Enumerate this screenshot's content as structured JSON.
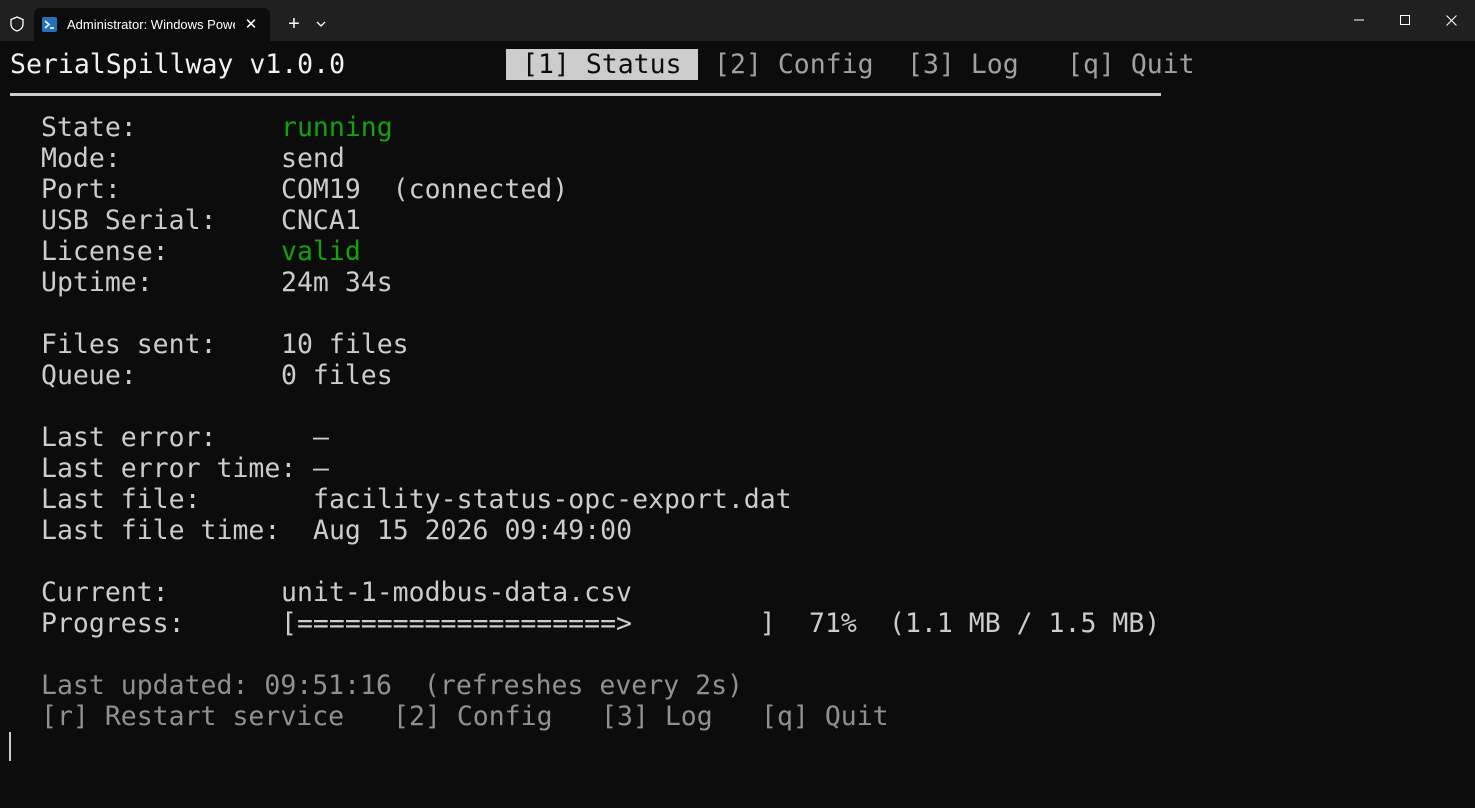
{
  "titlebar": {
    "tab_title": "Administrator: Windows PowerShell",
    "tab_close": "✕",
    "new_tab": "+"
  },
  "app": {
    "title": "SerialSpillway v1.0.0"
  },
  "menu": {
    "status": "[1] Status",
    "config": "[2] Config",
    "log": "[3] Log",
    "quit": "[q] Quit"
  },
  "status": {
    "state_label": "State:",
    "state_value": "running",
    "mode_label": "Mode:",
    "mode_value": "send",
    "port_label": "Port:",
    "port_value": "COM19  (connected)",
    "usb_label": "USB Serial:",
    "usb_value": "CNCA1",
    "license_label": "License:",
    "license_value": "valid",
    "uptime_label": "Uptime:",
    "uptime_value": "24m 34s",
    "files_sent_label": "Files sent:",
    "files_sent_value": "10 files",
    "queue_label": "Queue:",
    "queue_value": "0 files",
    "last_error_label": "Last error:",
    "last_error_value": "—",
    "last_error_time_label": "Last error time:",
    "last_error_time_value": "—",
    "last_file_label": "Last file:",
    "last_file_value": "facility-status-opc-export.dat",
    "last_file_time_label": "Last file time:",
    "last_file_time_value": "Aug 15 2026 09:49:00",
    "current_label": "Current:",
    "current_value": "unit-1-modbus-data.csv",
    "progress_label": "Progress:",
    "progress_bar": "[====================>        ]",
    "progress_percent": "71%",
    "progress_bytes": "(1.1 MB / 1.5 MB)",
    "progress_fraction": 0.71
  },
  "footer": {
    "last_updated": "Last updated: 09:51:16  (refreshes every 2s)",
    "restart": "[r] Restart service",
    "config": "[2] Config",
    "log": "[3] Log",
    "quit": "[q] Quit"
  },
  "colors": {
    "background": "#0c0c0c",
    "foreground": "#cccccc",
    "green": "#13a10e",
    "titlebar": "#202020"
  }
}
